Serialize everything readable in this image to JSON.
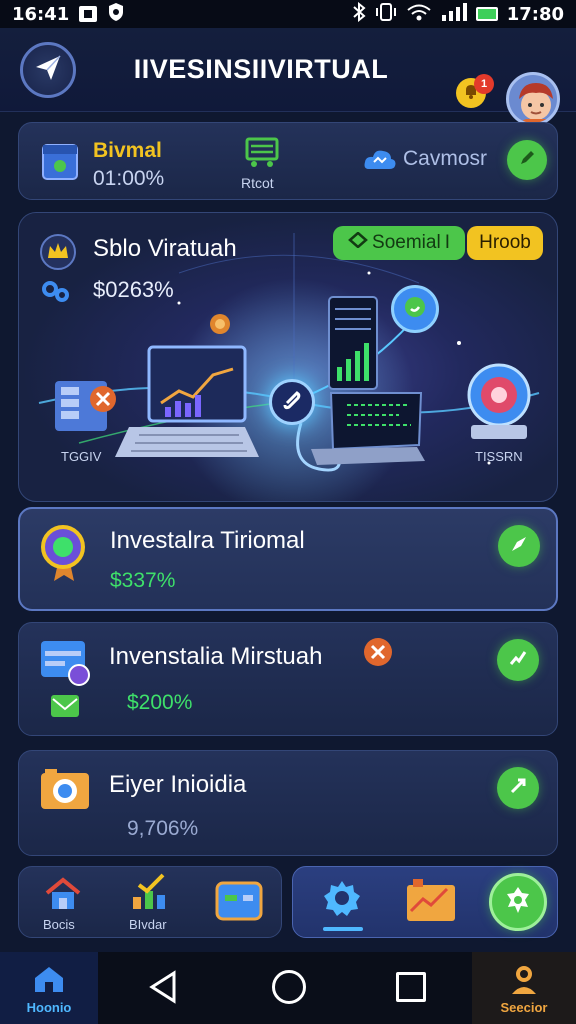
{
  "status_bar": {
    "time_left": "16:41",
    "time_right": "17:80"
  },
  "header": {
    "title": "IIVESINSIIVIRTUAL",
    "notification_count": "1"
  },
  "top_card": {
    "name": "Bivmal",
    "value": "01:00%",
    "middle_label": "Rtcot",
    "right_label": "Cavmosr"
  },
  "hero": {
    "title": "Sblo Viratuah",
    "value": "$0263%",
    "badge_green": "Soemial",
    "badge_green_suffix": "I",
    "badge_yellow": "Hroob",
    "label_left": "TGGIV",
    "label_right": "TISSRN"
  },
  "items": [
    {
      "title": "Investalra Tiriomal",
      "value": "$337%"
    },
    {
      "title": "Invenstalia Mirstuah",
      "value": "$200%"
    },
    {
      "title": "Eiyer Inioidia",
      "value": "9,706%"
    }
  ],
  "dock": {
    "home_label": "Bocis",
    "chart_label": "BIvdar"
  },
  "bottom_nav": {
    "home_label": "Hoonio",
    "profile_label": "Seecior"
  },
  "colors": {
    "accent_green": "#4cc64a",
    "accent_yellow": "#f2c321",
    "value_green": "#3ee06a",
    "background": "#0f1830",
    "card": "#24325a"
  }
}
